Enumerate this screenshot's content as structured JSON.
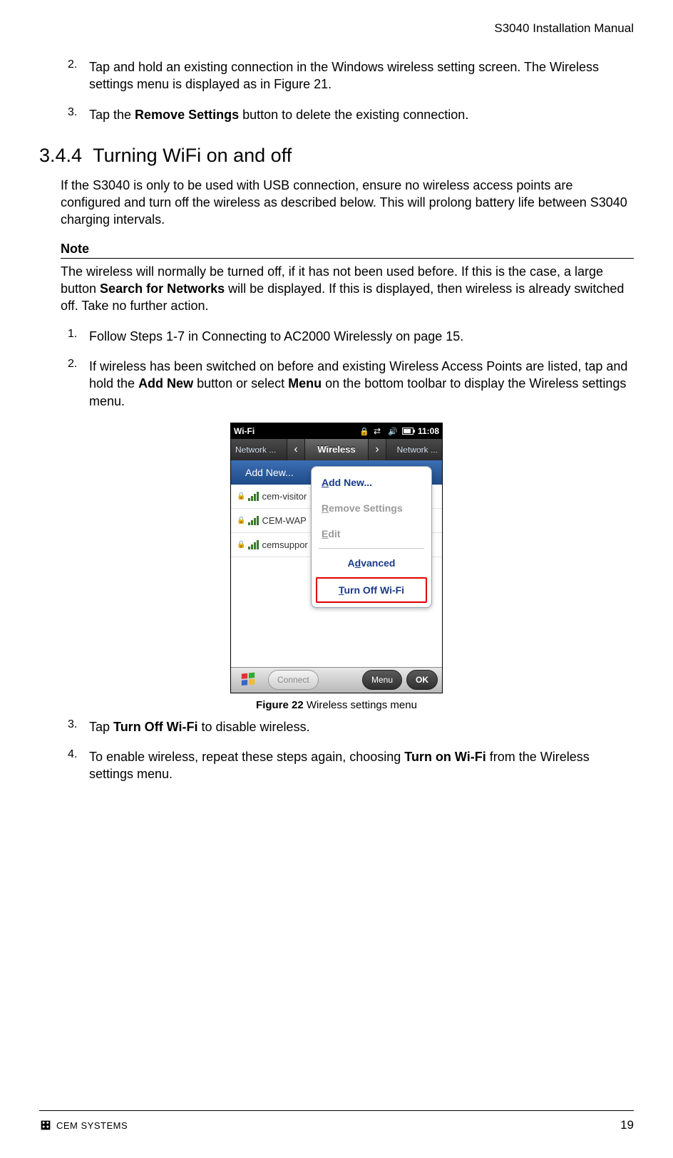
{
  "header": {
    "title": "S3040 Installation Manual"
  },
  "steps_a": [
    {
      "num": "2.",
      "before": "Tap and hold an existing connection in the Windows wireless setting screen. The Wireless settings menu is displayed as in Figure 21."
    },
    {
      "num": "3.",
      "before": "Tap the ",
      "bold": "Remove Settings",
      "after": " button to delete the existing connection."
    }
  ],
  "section": {
    "number": "3.4.4",
    "title": "Turning WiFi on and off"
  },
  "intro": "If the S3040 is only to be used with USB connection, ensure no wireless access points are configured and turn off the wireless as described below. This will prolong battery life between S3040 charging intervals.",
  "note": {
    "label": "Note",
    "p1": "The wireless will normally be turned off, if it has not been used before. If this is the case, a large button ",
    "b1": "Search for Networks",
    "p2": " will be displayed. If this is displayed, then wireless is already switched off. Take no further action."
  },
  "steps_b": {
    "s1": {
      "num": "1.",
      "text": "Follow Steps 1-7 in Connecting to AC2000 Wirelessly on page 15."
    },
    "s2": {
      "num": "2.",
      "p1": "If wireless has been switched on before and existing Wireless Access Points are listed, tap and hold the ",
      "b1": "Add New",
      "p2": " button or select ",
      "b2": "Menu",
      "p3": " on the bottom toolbar to display the Wireless settings menu."
    },
    "s3": {
      "num": "3.",
      "p1": "Tap ",
      "b1": "Turn Off Wi-Fi",
      "p2": " to disable wireless."
    },
    "s4": {
      "num": "4.",
      "p1": "To enable wireless, repeat these steps again, choosing ",
      "b1": "Turn on Wi-Fi",
      "p2": " from the Wireless settings menu."
    }
  },
  "figure": {
    "caption_bold": "Figure 22 ",
    "caption_rest": "Wireless settings menu",
    "status": {
      "title": "Wi-Fi",
      "time": "11:08"
    },
    "tabs": {
      "left": "Network ...",
      "center": "Wireless",
      "right": "Network ..."
    },
    "add_new_row": "Add New...",
    "networks": [
      "cem-visitor",
      "CEM-WAP",
      "cemsuppor"
    ],
    "menu": {
      "add_u": "A",
      "add_rest": "dd New...",
      "remove_u": "R",
      "remove_rest": "emove Settings",
      "edit_u": "E",
      "edit_rest": "dit",
      "adv_pre": "A",
      "adv_u": "d",
      "adv_rest": "vanced",
      "turn_u": "T",
      "turn_rest": "urn Off Wi-Fi"
    },
    "bottom": {
      "connect": "Connect",
      "menu": "Menu",
      "ok": "OK"
    }
  },
  "footer": {
    "brand": "CEM SYSTEMS",
    "page": "19"
  }
}
